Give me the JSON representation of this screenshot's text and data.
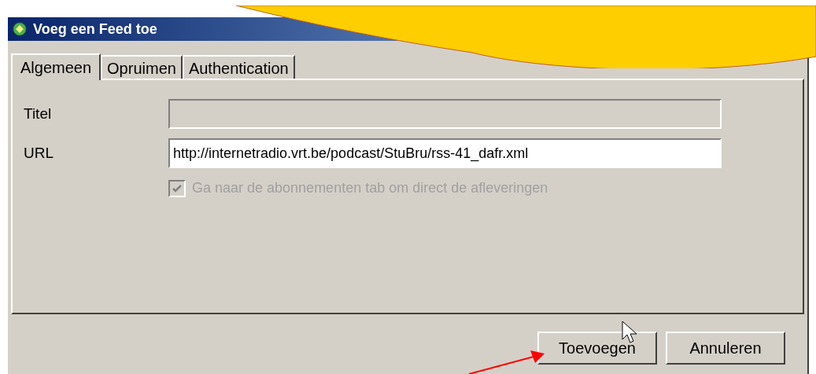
{
  "window": {
    "title": "Voeg een Feed toe"
  },
  "tabs": [
    {
      "label": "Algemeen",
      "selected": true
    },
    {
      "label": "Opruimen",
      "selected": false
    },
    {
      "label": "Authentication",
      "selected": false
    }
  ],
  "fields": [
    {
      "label": "Titel",
      "disabled": true
    },
    {
      "label": "URL",
      "value": "http://internetradio.vrt.be/podcast/StuBru/rss-41_dafr.xml",
      "disabled": false
    }
  ],
  "checkbox": {
    "label": "Ga naar de abonnementen tab om direct de afleveringen",
    "checked": true,
    "disabled": true
  },
  "buttons": [
    "Toevoegen",
    "Annuleren"
  ]
}
